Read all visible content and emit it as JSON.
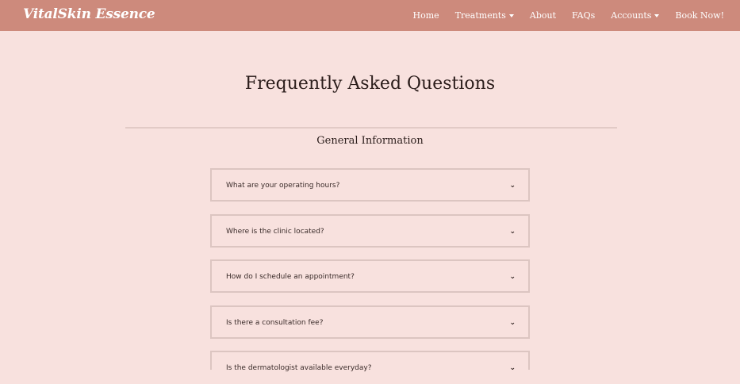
{
  "brand": "VitalSkin Essence",
  "nav": {
    "home": "Home",
    "treatments": "Treatments",
    "about": "About",
    "faqs": "FAQs",
    "accounts": "Accounts",
    "book": "Book Now!"
  },
  "page_title": "Frequently Asked Questions",
  "section_title": "General Information",
  "faq": [
    {
      "question": "What are your operating hours?"
    },
    {
      "question": "Where is the clinic located?"
    },
    {
      "question": "How do I schedule an appointment?"
    },
    {
      "question": "Is there a consultation fee?"
    },
    {
      "question": "Is the dermatologist available everyday?"
    }
  ],
  "icons": {
    "dropdown": "caret-down-icon",
    "expand": "chevron-down-icon"
  },
  "colors": {
    "navbar": "#cd8a7c",
    "background": "#f8e1de",
    "border": "#dcc5c1"
  }
}
